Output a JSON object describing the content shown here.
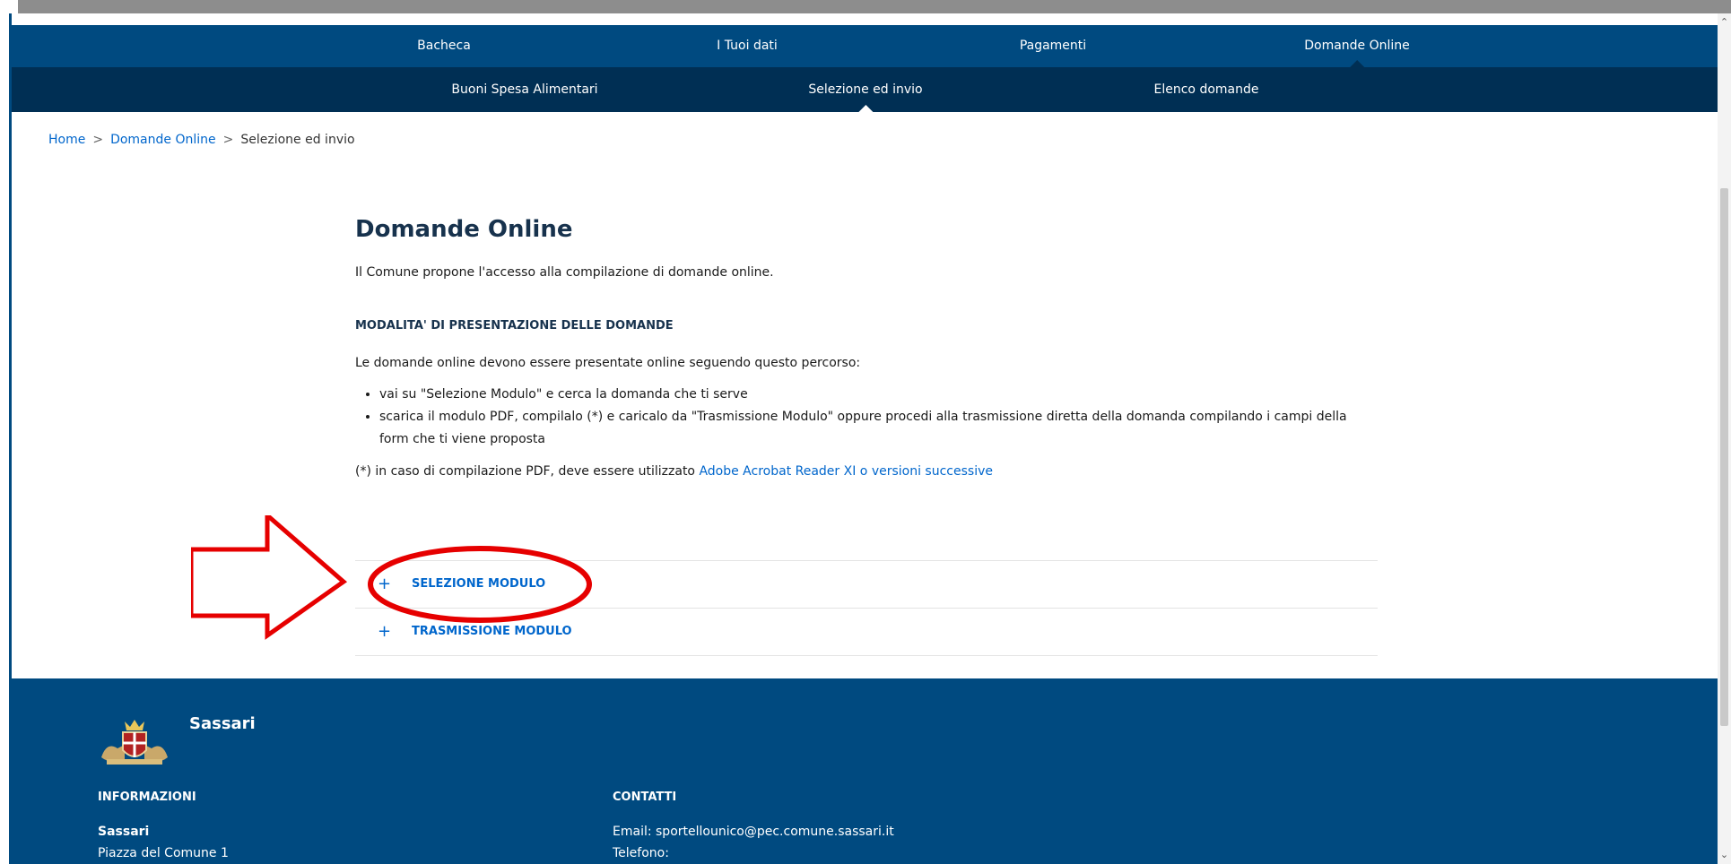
{
  "nav": {
    "primary": [
      "Bacheca",
      "I Tuoi dati",
      "Pagamenti",
      "Domande Online"
    ],
    "secondary": [
      "Buoni Spesa Alimentari",
      "Selezione ed invio",
      "Elenco domande"
    ]
  },
  "breadcrumb": {
    "home": "Home",
    "section": "Domande Online",
    "current": "Selezione ed invio",
    "separator": ">"
  },
  "main": {
    "title": "Domande Online",
    "intro": "Il Comune propone l'accesso alla compilazione di domande online.",
    "subheading": "MODALITA' DI PRESENTAZIONE DELLE DOMANDE",
    "paragraph": "Le domande online devono essere presentate online seguendo questo percorso:",
    "steps": [
      "vai su \"Selezione Modulo\" e cerca la domanda che ti serve",
      "scarica il modulo PDF, compilalo (*) e caricalo da \"Trasmissione Modulo\" oppure procedi alla trasmissione diretta della domanda compilando i campi della form che ti viene proposta"
    ],
    "note_text": "(*) in caso di compilazione PDF, deve essere utilizzato",
    "note_link": "Adobe Acrobat Reader XI o versioni successive"
  },
  "accordion": {
    "plus": "+",
    "items": [
      "SELEZIONE MODULO",
      "TRASMISSIONE MODULO"
    ]
  },
  "footer": {
    "brand": "Sassari",
    "info_heading": "INFORMAZIONI",
    "info_name": "Sassari",
    "info_address": "Piazza del Comune 1",
    "contacts_heading": "CONTATTI",
    "email": "Email: sportellounico@pec.comune.sassari.it",
    "phone": "Telefono:"
  },
  "colors": {
    "nav_primary": "#004a80",
    "nav_secondary": "#002f54",
    "link": "#0066cc",
    "annotation": "#e60000"
  }
}
